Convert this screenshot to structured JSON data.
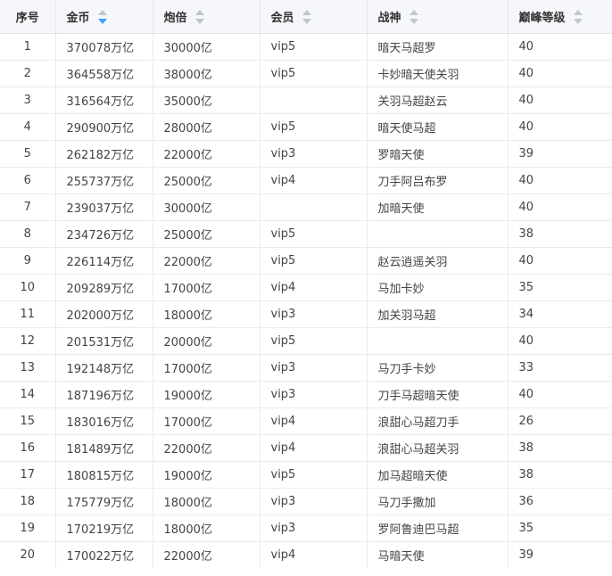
{
  "colors": {
    "header_bg": "#f5f7fa",
    "sort_active": "#409eff",
    "sort_inactive": "#c0c4cc",
    "border": "#ebebeb"
  },
  "columns": [
    {
      "label": "序号",
      "sortable": false
    },
    {
      "label": "金币",
      "sortable": true,
      "sort_state": "descending"
    },
    {
      "label": "炮倍",
      "sortable": true,
      "sort_state": "none"
    },
    {
      "label": "会员",
      "sortable": true,
      "sort_state": "none"
    },
    {
      "label": "战神",
      "sortable": true,
      "sort_state": "none"
    },
    {
      "label": "巅峰等级",
      "sortable": true,
      "sort_state": "none"
    }
  ],
  "rows": [
    [
      "1",
      "370078万亿",
      "30000亿",
      "vip5",
      "暗天马超罗",
      "40"
    ],
    [
      "2",
      "364558万亿",
      "38000亿",
      "vip5",
      "卡妙暗天使关羽",
      "40"
    ],
    [
      "3",
      "316564万亿",
      "35000亿",
      "",
      "关羽马超赵云",
      "40"
    ],
    [
      "4",
      "290900万亿",
      "28000亿",
      "vip5",
      "暗天使马超",
      "40"
    ],
    [
      "5",
      "262182万亿",
      "22000亿",
      "vip3",
      "罗暗天使",
      "39"
    ],
    [
      "6",
      "255737万亿",
      "25000亿",
      "vip4",
      "刀手阿吕布罗",
      "40"
    ],
    [
      "7",
      "239037万亿",
      "30000亿",
      "",
      "加暗天使",
      "40"
    ],
    [
      "8",
      "234726万亿",
      "25000亿",
      "vip5",
      "",
      "38"
    ],
    [
      "9",
      "226114万亿",
      "22000亿",
      "vip5",
      "赵云逍遥关羽",
      "40"
    ],
    [
      "10",
      "209289万亿",
      "17000亿",
      "vip4",
      "马加卡妙",
      "35"
    ],
    [
      "11",
      "202000万亿",
      "18000亿",
      "vip3",
      "加关羽马超",
      "34"
    ],
    [
      "12",
      "201531万亿",
      "20000亿",
      "vip5",
      "",
      "40"
    ],
    [
      "13",
      "192148万亿",
      "17000亿",
      "vip3",
      "马刀手卡妙",
      "33"
    ],
    [
      "14",
      "187196万亿",
      "19000亿",
      "vip3",
      "刀手马超暗天使",
      "40"
    ],
    [
      "15",
      "183016万亿",
      "17000亿",
      "vip4",
      "浪甜心马超刀手",
      "26"
    ],
    [
      "16",
      "181489万亿",
      "22000亿",
      "vip4",
      "浪甜心马超关羽",
      "38"
    ],
    [
      "17",
      "180815万亿",
      "19000亿",
      "vip5",
      "加马超暗天使",
      "38"
    ],
    [
      "18",
      "175779万亿",
      "18000亿",
      "vip3",
      "马刀手撒加",
      "36"
    ],
    [
      "19",
      "170219万亿",
      "18000亿",
      "vip3",
      "罗阿鲁迪巴马超",
      "35"
    ],
    [
      "20",
      "170022万亿",
      "22000亿",
      "vip4",
      "马暗天使",
      "39"
    ]
  ]
}
